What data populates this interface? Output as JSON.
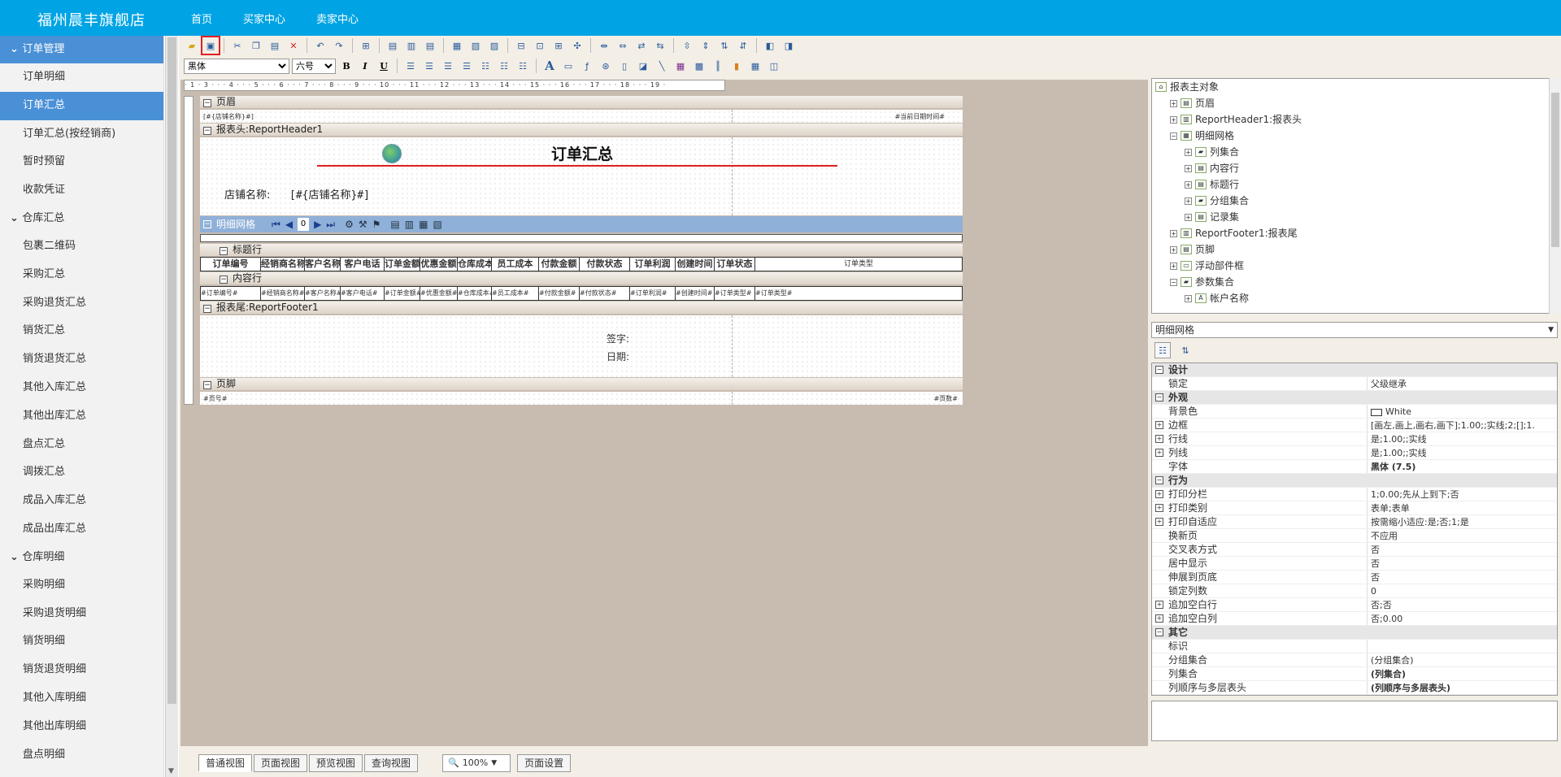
{
  "header": {
    "brand": "福州晨丰旗舰店",
    "nav": [
      "首页",
      "买家中心",
      "卖家中心"
    ]
  },
  "sidebar": {
    "groups": [
      {
        "label": "订单管理",
        "active": true,
        "items": [
          "订单明细",
          "订单汇总",
          "订单汇总(按经销商)",
          "暂时预留",
          "收款凭证"
        ],
        "selected": 1
      },
      {
        "label": "仓库汇总",
        "active": false,
        "items": [
          "包裹二维码",
          "采购汇总",
          "采购退货汇总",
          "销货汇总",
          "销货退货汇总",
          "其他入库汇总",
          "其他出库汇总",
          "盘点汇总",
          "调拨汇总",
          "成品入库汇总",
          "成品出库汇总"
        ]
      },
      {
        "label": "仓库明细",
        "active": false,
        "items": [
          "采购明细",
          "采购退货明细",
          "销货明细",
          "销货退货明细",
          "其他入库明细",
          "其他出库明细",
          "盘点明细"
        ]
      }
    ]
  },
  "toolbar": {
    "font_name": "黑体",
    "font_size": "六号",
    "bold": "B",
    "italic": "I",
    "underline": "U"
  },
  "ruler": {
    "text": "· 1 · 3 · · · 4 · · · 5 · · · 6 · · · 7 · · · 8 · · · 9 · · · 10 · · · 11 · · · 12 · · · 13 · · · 14 · · · 15 · · · 16 · · · 17 · · · 18 · · · 19 ·"
  },
  "report": {
    "page_header": {
      "band": "页眉",
      "left": "[#{店铺名称}#]",
      "right": "#当前日期时间#"
    },
    "report_header": {
      "band": "报表头:ReportHeader1",
      "title": "订单汇总",
      "shop_label": "店铺名称:",
      "shop_value": "[#{店铺名称}#]"
    },
    "grid": {
      "band": "明细网格",
      "page_num": "0"
    },
    "title_row": {
      "band": "标题行",
      "cells": [
        "订单编号",
        "经销商名称",
        "客户名称",
        "客户电话",
        "订单金额",
        "优惠金额",
        "仓库成本",
        "员工成本",
        "付款金额",
        "付款状态",
        "订单利润",
        "创建时间",
        "订单状态",
        "订单类型"
      ]
    },
    "content_row": {
      "band": "内容行",
      "cells": [
        "#订单编号#",
        "#经销商名称#",
        "#客户名称#",
        "#客户电话#",
        "#订单金额#",
        "#优惠金额#",
        "#仓库成本#",
        "#员工成本#",
        "#付款金额#",
        "#付款状态#",
        "#订单利润#",
        "#创建时间#",
        "#订单类型#",
        "#订单类型#"
      ]
    },
    "report_footer": {
      "band": "报表尾:ReportFooter1",
      "sign": "签字:",
      "date": "日期:"
    },
    "page_footer": {
      "band": "页脚",
      "left": "#页号#",
      "right": "#页数#"
    }
  },
  "tree": {
    "nodes": [
      {
        "label": "报表主对象",
        "level": 0
      },
      {
        "label": "页眉",
        "level": 1
      },
      {
        "label": "ReportHeader1:报表头",
        "level": 1
      },
      {
        "label": "明细网格",
        "level": 1
      },
      {
        "label": "列集合",
        "level": 2
      },
      {
        "label": "内容行",
        "level": 2
      },
      {
        "label": "标题行",
        "level": 2
      },
      {
        "label": "分组集合",
        "level": 2
      },
      {
        "label": "记录集",
        "level": 2
      },
      {
        "label": "ReportFooter1:报表尾",
        "level": 1
      },
      {
        "label": "页脚",
        "level": 1
      },
      {
        "label": "浮动部件框",
        "level": 1
      },
      {
        "label": "参数集合",
        "level": 1
      },
      {
        "label": "帐户名称",
        "level": 2
      }
    ]
  },
  "object_select": "明细网格",
  "properties": [
    {
      "cat": true,
      "k": "设计"
    },
    {
      "k": "锁定",
      "v": "父级继承"
    },
    {
      "cat": true,
      "k": "外观"
    },
    {
      "k": "背景色",
      "v": "White"
    },
    {
      "k": "边框",
      "v": "[画左,画上,画右,画下];1.00;;实线;2;[];1.",
      "pm": true
    },
    {
      "k": "行线",
      "v": "是;1.00;;实线",
      "pm": true
    },
    {
      "k": "列线",
      "v": "是;1.00;;实线",
      "pm": true
    },
    {
      "k": "字体",
      "v": "黑体 (7.5)"
    },
    {
      "cat": true,
      "k": "行为"
    },
    {
      "k": "打印分栏",
      "v": "1;0.00;先从上到下;否",
      "pm": true
    },
    {
      "k": "打印类别",
      "v": "表单;表单",
      "pm": true
    },
    {
      "k": "打印自适应",
      "v": "按需缩小适应:是;否;1;是",
      "pm": true
    },
    {
      "k": "换新页",
      "v": "不应用"
    },
    {
      "k": "交叉表方式",
      "v": "否"
    },
    {
      "k": "居中显示",
      "v": "否"
    },
    {
      "k": "伸展到页底",
      "v": "否"
    },
    {
      "k": "锁定列数",
      "v": "0"
    },
    {
      "k": "追加空白行",
      "v": "否;否",
      "pm": true
    },
    {
      "k": "追加空白列",
      "v": "否;0.00",
      "pm": true
    },
    {
      "cat": true,
      "k": "其它"
    },
    {
      "k": "标识",
      "v": ""
    },
    {
      "k": "分组集合",
      "v": "(分组集合)"
    },
    {
      "k": "列集合",
      "v": "(列集合)"
    },
    {
      "k": "列顺序与多层表头",
      "v": "(列顺序与多层表头)"
    }
  ],
  "bottom_tabs": [
    "普通视图",
    "页面视图",
    "预览视图",
    "查询视图"
  ],
  "zoom": "100%",
  "page_setup": "页面设置"
}
